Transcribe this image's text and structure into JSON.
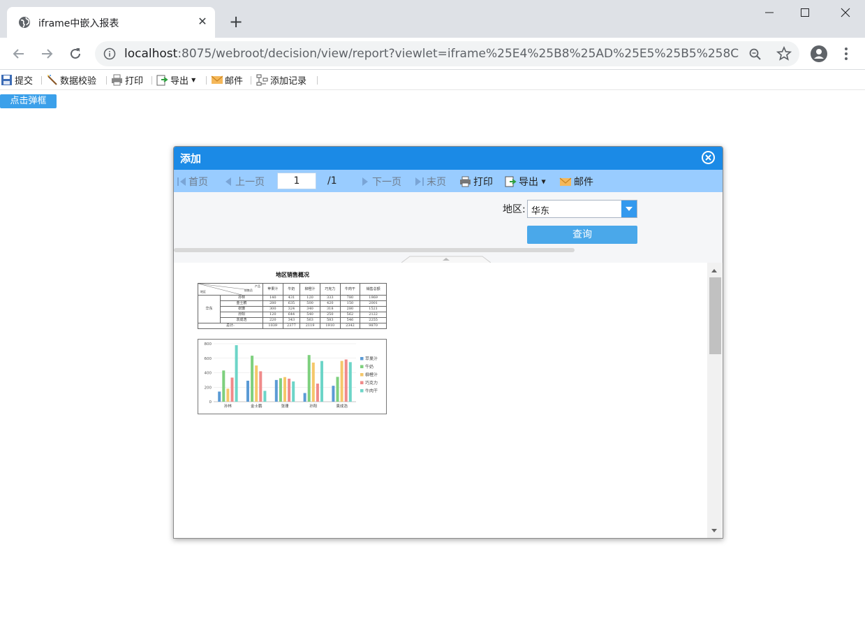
{
  "browser": {
    "tab_title": "iframe中嵌入报表",
    "url_host": "localhost",
    "url_rest": ":8075/webroot/decision/view/report?viewlet=iframe%25E4%25B8%25AD%25E5%25B5%258C..."
  },
  "page_toolbar": {
    "submit": "提交",
    "validate": "数据校验",
    "print": "打印",
    "export": "导出",
    "mail": "邮件",
    "add_record": "添加记录"
  },
  "popup_button": "点击弹框",
  "dialog": {
    "title": "添加",
    "toolbar": {
      "first": "首页",
      "prev": "上一页",
      "page_current": "1",
      "page_total": "/1",
      "next": "下一页",
      "last": "末页",
      "print": "打印",
      "export": "导出",
      "mail": "邮件"
    },
    "params": {
      "region_label": "地区:",
      "region_value": "华东",
      "query_button": "查询"
    }
  },
  "report": {
    "title": "地区销售概况",
    "table": {
      "corner": [
        "产品",
        "销售员",
        "地区"
      ],
      "headers": [
        "苹果汁",
        "牛奶",
        "柳橙汁",
        "巧克力",
        "牛肉干",
        "销售总额"
      ],
      "region": "华东",
      "rows": [
        {
          "name": "孙林",
          "values": [
            "140",
            "431",
            "120",
            "333",
            "780",
            "1969"
          ]
        },
        {
          "name": "金士鹏",
          "values": [
            "280",
            "635",
            "500",
            "420",
            "150",
            "2001"
          ]
        },
        {
          "name": "张珊",
          "values": [
            "300",
            "324",
            "340",
            "318",
            "280",
            "1521"
          ]
        },
        {
          "name": "孙阳",
          "values": [
            "120",
            "644",
            "540",
            "250",
            "562",
            "2122"
          ]
        },
        {
          "name": "袁成浩",
          "values": [
            "220",
            "343",
            "563",
            "583",
            "546",
            "2255"
          ]
        }
      ],
      "total_label": "总计:",
      "totals": [
        "1039",
        "2377",
        "2119",
        "1910",
        "2342",
        "9870"
      ]
    }
  },
  "chart_data": {
    "type": "bar",
    "categories": [
      "孙林",
      "金士鹏",
      "张珊",
      "孙阳",
      "袁成浩"
    ],
    "series": [
      {
        "name": "苹果汁",
        "color": "#5b9bd5",
        "values": [
          140,
          290,
          300,
          120,
          220
        ]
      },
      {
        "name": "牛奶",
        "color": "#7ed07e",
        "values": [
          431,
          635,
          324,
          644,
          343
        ]
      },
      {
        "name": "柳橙汁",
        "color": "#f5c76a",
        "values": [
          180,
          500,
          340,
          540,
          563
        ]
      },
      {
        "name": "巧克力",
        "color": "#f08a8a",
        "values": [
          333,
          420,
          318,
          250,
          583
        ]
      },
      {
        "name": "牛肉干",
        "color": "#6dd5c8",
        "values": [
          780,
          150,
          280,
          562,
          546
        ]
      }
    ],
    "yticks": [
      "0",
      "200",
      "400",
      "600",
      "800"
    ],
    "ylim": [
      0,
      800
    ],
    "legend": "right",
    "grid": true
  }
}
